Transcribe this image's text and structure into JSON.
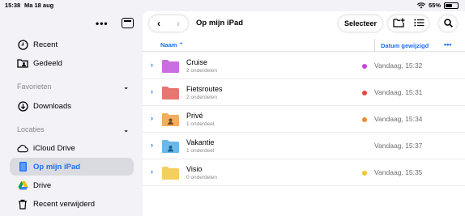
{
  "status": {
    "time": "15:38",
    "date": "Ma 18 aug",
    "battery": "55%",
    "battery_level": 0.55
  },
  "sidebar": {
    "top_items": [
      {
        "label": "Recent",
        "icon": "clock-icon"
      },
      {
        "label": "Gedeeld",
        "icon": "shared-folder-icon"
      }
    ],
    "favorites_header": "Favorieten",
    "favorites": [
      {
        "label": "Downloads",
        "icon": "download-icon"
      }
    ],
    "locations_header": "Locaties",
    "locations": [
      {
        "label": "iCloud Drive",
        "icon": "cloud-icon",
        "active": false
      },
      {
        "label": "Op mijn iPad",
        "icon": "ipad-icon",
        "active": true
      },
      {
        "label": "Drive",
        "icon": "google-drive-icon",
        "active": false
      },
      {
        "label": "Recent verwijderd",
        "icon": "trash-icon",
        "active": false
      }
    ]
  },
  "toolbar": {
    "title": "Op mijn iPad",
    "select_label": "Selecteer"
  },
  "columns": {
    "name": "Naam",
    "date": "Datum gewijzigd"
  },
  "files": [
    {
      "name": "Cruise",
      "sub": "2 onderdelen",
      "date": "Vandaag, 15:32",
      "tag_color": "#c945d8",
      "folder_color": "#c86ee0",
      "badge": ""
    },
    {
      "name": "Fietsroutes",
      "sub": "2 onderdelen",
      "date": "Vandaag, 15:31",
      "tag_color": "#e8453c",
      "folder_color": "#e67570",
      "badge": ""
    },
    {
      "name": "Privé",
      "sub": "1 onderdeel",
      "date": "Vandaag, 15:34",
      "tag_color": "#f08a30",
      "folder_color": "#f2ad61",
      "badge": "person-badge-icon"
    },
    {
      "name": "Vakantie",
      "sub": "1 onderdeel",
      "date": "Vandaag, 15:37",
      "tag_color": "",
      "folder_color": "#6ab9e8",
      "badge": "shared-badge-icon"
    },
    {
      "name": "Visio",
      "sub": "0 onderdelen",
      "date": "Vandaag, 15:35",
      "tag_color": "#f2c530",
      "folder_color": "#f5cf5c",
      "badge": ""
    }
  ],
  "colors": {
    "accent": "#1a6ef5",
    "sidebar_bg": "#f2f2f7",
    "selection_bg": "#dadbe0"
  }
}
